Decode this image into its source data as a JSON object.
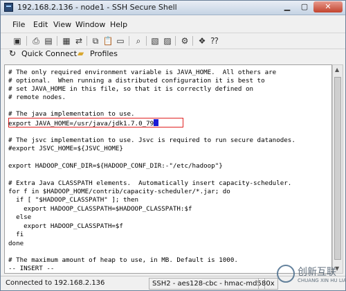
{
  "window": {
    "title": "192.168.2.136 - node1 - SSH Secure Shell"
  },
  "menu": [
    "File",
    "Edit",
    "View",
    "Window",
    "Help"
  ],
  "toolbar2": {
    "quick_connect": "Quick Connect",
    "profiles": "Profiles"
  },
  "terminal": {
    "lines": [
      "# The only required environment variable is JAVA_HOME.  All others are",
      "# optional.  When running a distributed configuration it is best to",
      "# set JAVA_HOME in this file, so that it is correctly defined on",
      "# remote nodes.",
      "",
      "# The java implementation to use.",
      "export JAVA_HOME=/usr/java/jdk1.7.0_79",
      "",
      "# The jsvc implementation to use. Jsvc is required to run secure datanodes.",
      "#export JSVC_HOME=${JSVC_HOME}",
      "",
      "export HADOOP_CONF_DIR=${HADOOP_CONF_DIR:-\"/etc/hadoop\"}",
      "",
      "# Extra Java CLASSPATH elements.  Automatically insert capacity-scheduler.",
      "for f in $HADOOP_HOME/contrib/capacity-scheduler/*.jar; do",
      "  if [ \"$HADOOP_CLASSPATH\" ]; then",
      "    export HADOOP_CLASSPATH=$HADOOP_CLASSPATH:$f",
      "  else",
      "    export HADOOP_CLASSPATH=$f",
      "  fi",
      "done",
      "",
      "# The maximum amount of heap to use, in MB. Default is 1000.",
      "-- INSERT --"
    ]
  },
  "status": {
    "connection": "Connected to 192.168.2.136",
    "cipher": "SSH2 - aes128-cbc - hmac-md5",
    "size": "80x"
  },
  "watermark": {
    "brand": "创新互联",
    "sub": "CHUANG XIN HU LIAN"
  }
}
